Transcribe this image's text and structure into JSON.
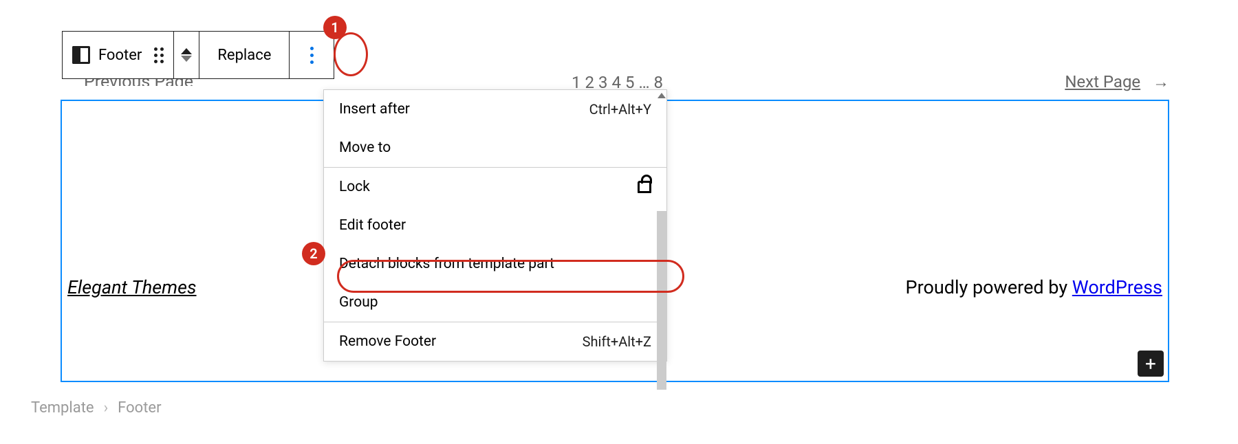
{
  "toolbar": {
    "block_label": "Footer",
    "replace_label": "Replace"
  },
  "pagination": {
    "previous": "Previous Page",
    "pages": [
      "1",
      "2",
      "3",
      "4",
      "5",
      "…",
      "8"
    ],
    "next": "Next Page"
  },
  "footer": {
    "site_name": "Elegant Themes",
    "credits_prefix": "Proudly powered by ",
    "credits_link": "WordPress"
  },
  "menu": {
    "insert_after": "Insert after",
    "insert_after_key": "Ctrl+Alt+Y",
    "move_to": "Move to",
    "lock": "Lock",
    "edit_footer": "Edit footer",
    "detach": "Detach blocks from template part",
    "group": "Group",
    "remove_footer": "Remove Footer",
    "remove_footer_key": "Shift+Alt+Z"
  },
  "breadcrumb": {
    "template": "Template",
    "footer": "Footer"
  },
  "annotations": {
    "badge1": "1",
    "badge2": "2"
  }
}
